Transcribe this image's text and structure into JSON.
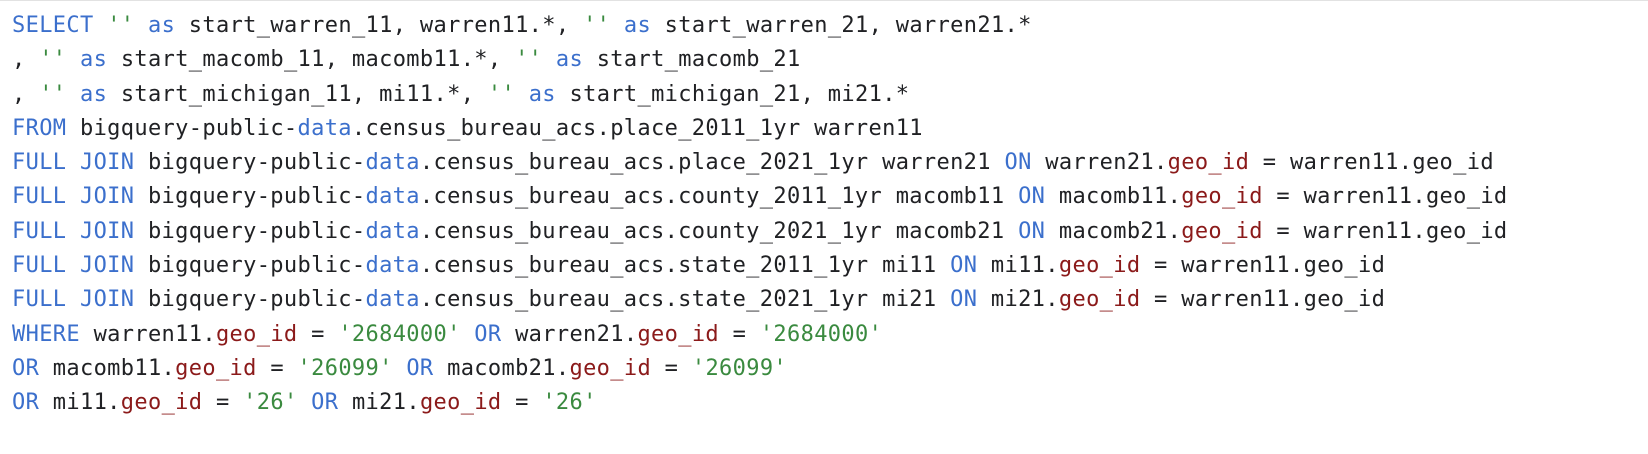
{
  "colors": {
    "keyword": "#3b6fcc",
    "string": "#3a8a3f",
    "column": "#8b1a1a",
    "text": "#202124",
    "background": "#ffffff"
  },
  "editor": {
    "language": "sql",
    "lines": [
      {
        "tokens": [
          {
            "t": "kw",
            "v": "SELECT"
          },
          {
            "t": "txt",
            "v": " "
          },
          {
            "t": "str",
            "v": "''"
          },
          {
            "t": "txt",
            "v": " "
          },
          {
            "t": "kw",
            "v": "as"
          },
          {
            "t": "txt",
            "v": " start_warren_11, warren11.*, "
          },
          {
            "t": "str",
            "v": "''"
          },
          {
            "t": "txt",
            "v": " "
          },
          {
            "t": "kw",
            "v": "as"
          },
          {
            "t": "txt",
            "v": " start_warren_21, warren21.*"
          }
        ]
      },
      {
        "tokens": [
          {
            "t": "txt",
            "v": ", "
          },
          {
            "t": "str",
            "v": "''"
          },
          {
            "t": "txt",
            "v": " "
          },
          {
            "t": "kw",
            "v": "as"
          },
          {
            "t": "txt",
            "v": " start_macomb_11, macomb11.*, "
          },
          {
            "t": "str",
            "v": "''"
          },
          {
            "t": "txt",
            "v": " "
          },
          {
            "t": "kw",
            "v": "as"
          },
          {
            "t": "txt",
            "v": " start_macomb_21"
          }
        ]
      },
      {
        "tokens": [
          {
            "t": "txt",
            "v": ", "
          },
          {
            "t": "str",
            "v": "''"
          },
          {
            "t": "txt",
            "v": " "
          },
          {
            "t": "kw",
            "v": "as"
          },
          {
            "t": "txt",
            "v": " start_michigan_11, mi11.*, "
          },
          {
            "t": "str",
            "v": "''"
          },
          {
            "t": "txt",
            "v": " "
          },
          {
            "t": "kw",
            "v": "as"
          },
          {
            "t": "txt",
            "v": " start_michigan_21, mi21.*"
          }
        ]
      },
      {
        "tokens": [
          {
            "t": "kw",
            "v": "FROM"
          },
          {
            "t": "txt",
            "v": " bigquery-public-"
          },
          {
            "t": "fn",
            "v": "data"
          },
          {
            "t": "txt",
            "v": ".census_bureau_acs.place_2011_1yr warren11"
          }
        ]
      },
      {
        "tokens": [
          {
            "t": "kw",
            "v": "FULL JOIN"
          },
          {
            "t": "txt",
            "v": " bigquery-public-"
          },
          {
            "t": "fn",
            "v": "data"
          },
          {
            "t": "txt",
            "v": ".census_bureau_acs.place_2021_1yr warren21 "
          },
          {
            "t": "kw",
            "v": "ON"
          },
          {
            "t": "txt",
            "v": " warren21."
          },
          {
            "t": "col",
            "v": "geo_id"
          },
          {
            "t": "txt",
            "v": " = warren11.geo_id"
          }
        ]
      },
      {
        "tokens": [
          {
            "t": "kw",
            "v": "FULL JOIN"
          },
          {
            "t": "txt",
            "v": " bigquery-public-"
          },
          {
            "t": "fn",
            "v": "data"
          },
          {
            "t": "txt",
            "v": ".census_bureau_acs.county_2011_1yr macomb11 "
          },
          {
            "t": "kw",
            "v": "ON"
          },
          {
            "t": "txt",
            "v": " macomb11."
          },
          {
            "t": "col",
            "v": "geo_id"
          },
          {
            "t": "txt",
            "v": " = warren11.geo_id"
          }
        ]
      },
      {
        "tokens": [
          {
            "t": "kw",
            "v": "FULL JOIN"
          },
          {
            "t": "txt",
            "v": " bigquery-public-"
          },
          {
            "t": "fn",
            "v": "data"
          },
          {
            "t": "txt",
            "v": ".census_bureau_acs.county_2021_1yr macomb21 "
          },
          {
            "t": "kw",
            "v": "ON"
          },
          {
            "t": "txt",
            "v": " macomb21."
          },
          {
            "t": "col",
            "v": "geo_id"
          },
          {
            "t": "txt",
            "v": " = warren11.geo_id"
          }
        ]
      },
      {
        "tokens": [
          {
            "t": "kw",
            "v": "FULL JOIN"
          },
          {
            "t": "txt",
            "v": " bigquery-public-"
          },
          {
            "t": "fn",
            "v": "data"
          },
          {
            "t": "txt",
            "v": ".census_bureau_acs.state_2011_1yr mi11 "
          },
          {
            "t": "kw",
            "v": "ON"
          },
          {
            "t": "txt",
            "v": " mi11."
          },
          {
            "t": "col",
            "v": "geo_id"
          },
          {
            "t": "txt",
            "v": " = warren11.geo_id"
          }
        ]
      },
      {
        "tokens": [
          {
            "t": "kw",
            "v": "FULL JOIN"
          },
          {
            "t": "txt",
            "v": " bigquery-public-"
          },
          {
            "t": "fn",
            "v": "data"
          },
          {
            "t": "txt",
            "v": ".census_bureau_acs.state_2021_1yr mi21 "
          },
          {
            "t": "kw",
            "v": "ON"
          },
          {
            "t": "txt",
            "v": " mi21."
          },
          {
            "t": "col",
            "v": "geo_id"
          },
          {
            "t": "txt",
            "v": " = warren11.geo_id"
          }
        ]
      },
      {
        "tokens": [
          {
            "t": "kw",
            "v": "WHERE"
          },
          {
            "t": "txt",
            "v": " warren11."
          },
          {
            "t": "col",
            "v": "geo_id"
          },
          {
            "t": "txt",
            "v": " = "
          },
          {
            "t": "str",
            "v": "'2684000'"
          },
          {
            "t": "txt",
            "v": " "
          },
          {
            "t": "kw",
            "v": "OR"
          },
          {
            "t": "txt",
            "v": " warren21."
          },
          {
            "t": "col",
            "v": "geo_id"
          },
          {
            "t": "txt",
            "v": " = "
          },
          {
            "t": "str",
            "v": "'2684000'"
          }
        ]
      },
      {
        "tokens": [
          {
            "t": "kw",
            "v": "OR"
          },
          {
            "t": "txt",
            "v": " macomb11."
          },
          {
            "t": "col",
            "v": "geo_id"
          },
          {
            "t": "txt",
            "v": " = "
          },
          {
            "t": "str",
            "v": "'26099'"
          },
          {
            "t": "txt",
            "v": " "
          },
          {
            "t": "kw",
            "v": "OR"
          },
          {
            "t": "txt",
            "v": " macomb21."
          },
          {
            "t": "col",
            "v": "geo_id"
          },
          {
            "t": "txt",
            "v": " = "
          },
          {
            "t": "str",
            "v": "'26099'"
          }
        ]
      },
      {
        "tokens": [
          {
            "t": "kw",
            "v": "OR"
          },
          {
            "t": "txt",
            "v": " mi11."
          },
          {
            "t": "col",
            "v": "geo_id"
          },
          {
            "t": "txt",
            "v": " = "
          },
          {
            "t": "str",
            "v": "'26'"
          },
          {
            "t": "txt",
            "v": " "
          },
          {
            "t": "kw",
            "v": "OR"
          },
          {
            "t": "txt",
            "v": " mi21."
          },
          {
            "t": "col",
            "v": "geo_id"
          },
          {
            "t": "txt",
            "v": " = "
          },
          {
            "t": "str",
            "v": "'26'"
          }
        ]
      }
    ]
  }
}
